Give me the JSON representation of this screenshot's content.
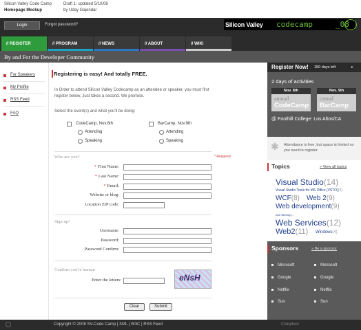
{
  "meta": {
    "title": "Silicon Valley Code Camp",
    "subtitle": "Homepage Mockup",
    "draft": "Draft 1: updated 5/10/08",
    "author": "by Uday Gajendar"
  },
  "header": {
    "login_label": "Login",
    "forgot_label": "Forgot password?",
    "logo_part1": "Silicon Valley",
    "logo_part2": "codecamp",
    "logo_part3": "_08"
  },
  "nav": {
    "tabs": [
      {
        "label": "// REGISTER",
        "color": "#2e9c3c"
      },
      {
        "label": "// PROGRAM",
        "color": "#1aa4c8"
      },
      {
        "label": "// NEWS",
        "color": "#2b78c8"
      },
      {
        "label": "// ABOUT",
        "color": "#7a4fb2"
      },
      {
        "label": "// WIKI",
        "color": "#cccccc"
      }
    ]
  },
  "tagline": "By and For the Developer Community",
  "leftnav": [
    "For Speakers",
    "My Profile",
    "RSS Feed",
    "FAQ"
  ],
  "main": {
    "headline": "Registering is easy! And totally FREE.",
    "intro": "In Order to attend Silicon Valley Codecamp as an attendee or speaker, you must first register below. Just takes a second. We promise.",
    "select_prompt": "Select the event(s) and what you'll be doing:",
    "events": [
      {
        "name": "CodeCamp, Nov.8th",
        "options": [
          "Attending",
          "Speaking"
        ]
      },
      {
        "name": "BarCamp, Nov.9th",
        "options": [
          "Attending",
          "Speaking"
        ]
      }
    ],
    "who_heading": "Who are you?",
    "required_label": "* Required",
    "fields_who": [
      {
        "label": "First Name:",
        "required": "*"
      },
      {
        "label": "Last Name:",
        "required": "*"
      },
      {
        "label": "Email:",
        "required": "*"
      },
      {
        "label": "Website or blog:",
        "required": ""
      },
      {
        "label": "Location ZIP code:",
        "required": ""
      }
    ],
    "signup_heading": "Sign up!",
    "fields_signup": [
      "Username:",
      "Password:",
      "Password Confirm:"
    ],
    "human_heading": "Confirm you're human",
    "captcha_prompt": "Enter the letters:",
    "captcha_text": "eNsH",
    "clear_label": "Clear",
    "submit_label": "Submit"
  },
  "right": {
    "register_now": "Register Now!",
    "days_left": "150 days left",
    "arrow": "▸",
    "activities": "2 days of activities",
    "cards": [
      {
        "date": "Nov. 8th",
        "line1": "annual",
        "line2": "CodeCamp"
      },
      {
        "date": "Nov. 9th",
        "line1": "casual",
        "line2": "BarCamp"
      }
    ],
    "location": "@ Foothill College: Los Altos/CA",
    "attendance": "Attendance is free, but space is limited so you need to register.",
    "topics_title": "Topics",
    "topics_link": "View all topics",
    "sponsors_title": "Sponsors",
    "sponsors_link": "Be a sponsor",
    "sponsors": [
      "Microsoft",
      "Microsoft",
      "Google",
      "Google",
      "Netflix",
      "Netflix",
      "Sun",
      "Sun"
    ]
  },
  "topics": [
    {
      "name": "Visual Studio",
      "count": "(14)"
    },
    {
      "name": "Visual Studio Tools for MS Office (VSTO)",
      "count": "(3)"
    },
    {
      "name": "WCF",
      "count": "(8)"
    },
    {
      "name": "Web 2",
      "count": "(9)"
    },
    {
      "name": "Web development",
      "count": "(9)"
    },
    {
      "name": "web filtering",
      "count": "(1)"
    },
    {
      "name": "Web Services",
      "count": "(12)"
    },
    {
      "name": "Web2",
      "count": "(11)"
    },
    {
      "name": "Windows",
      "count": "(4)"
    }
  ],
  "footer": {
    "text": "Copyright © 2008 SV-Code Camp  |  XML  |  W3C  |  RSS Feed",
    "credit": "Colophon"
  }
}
